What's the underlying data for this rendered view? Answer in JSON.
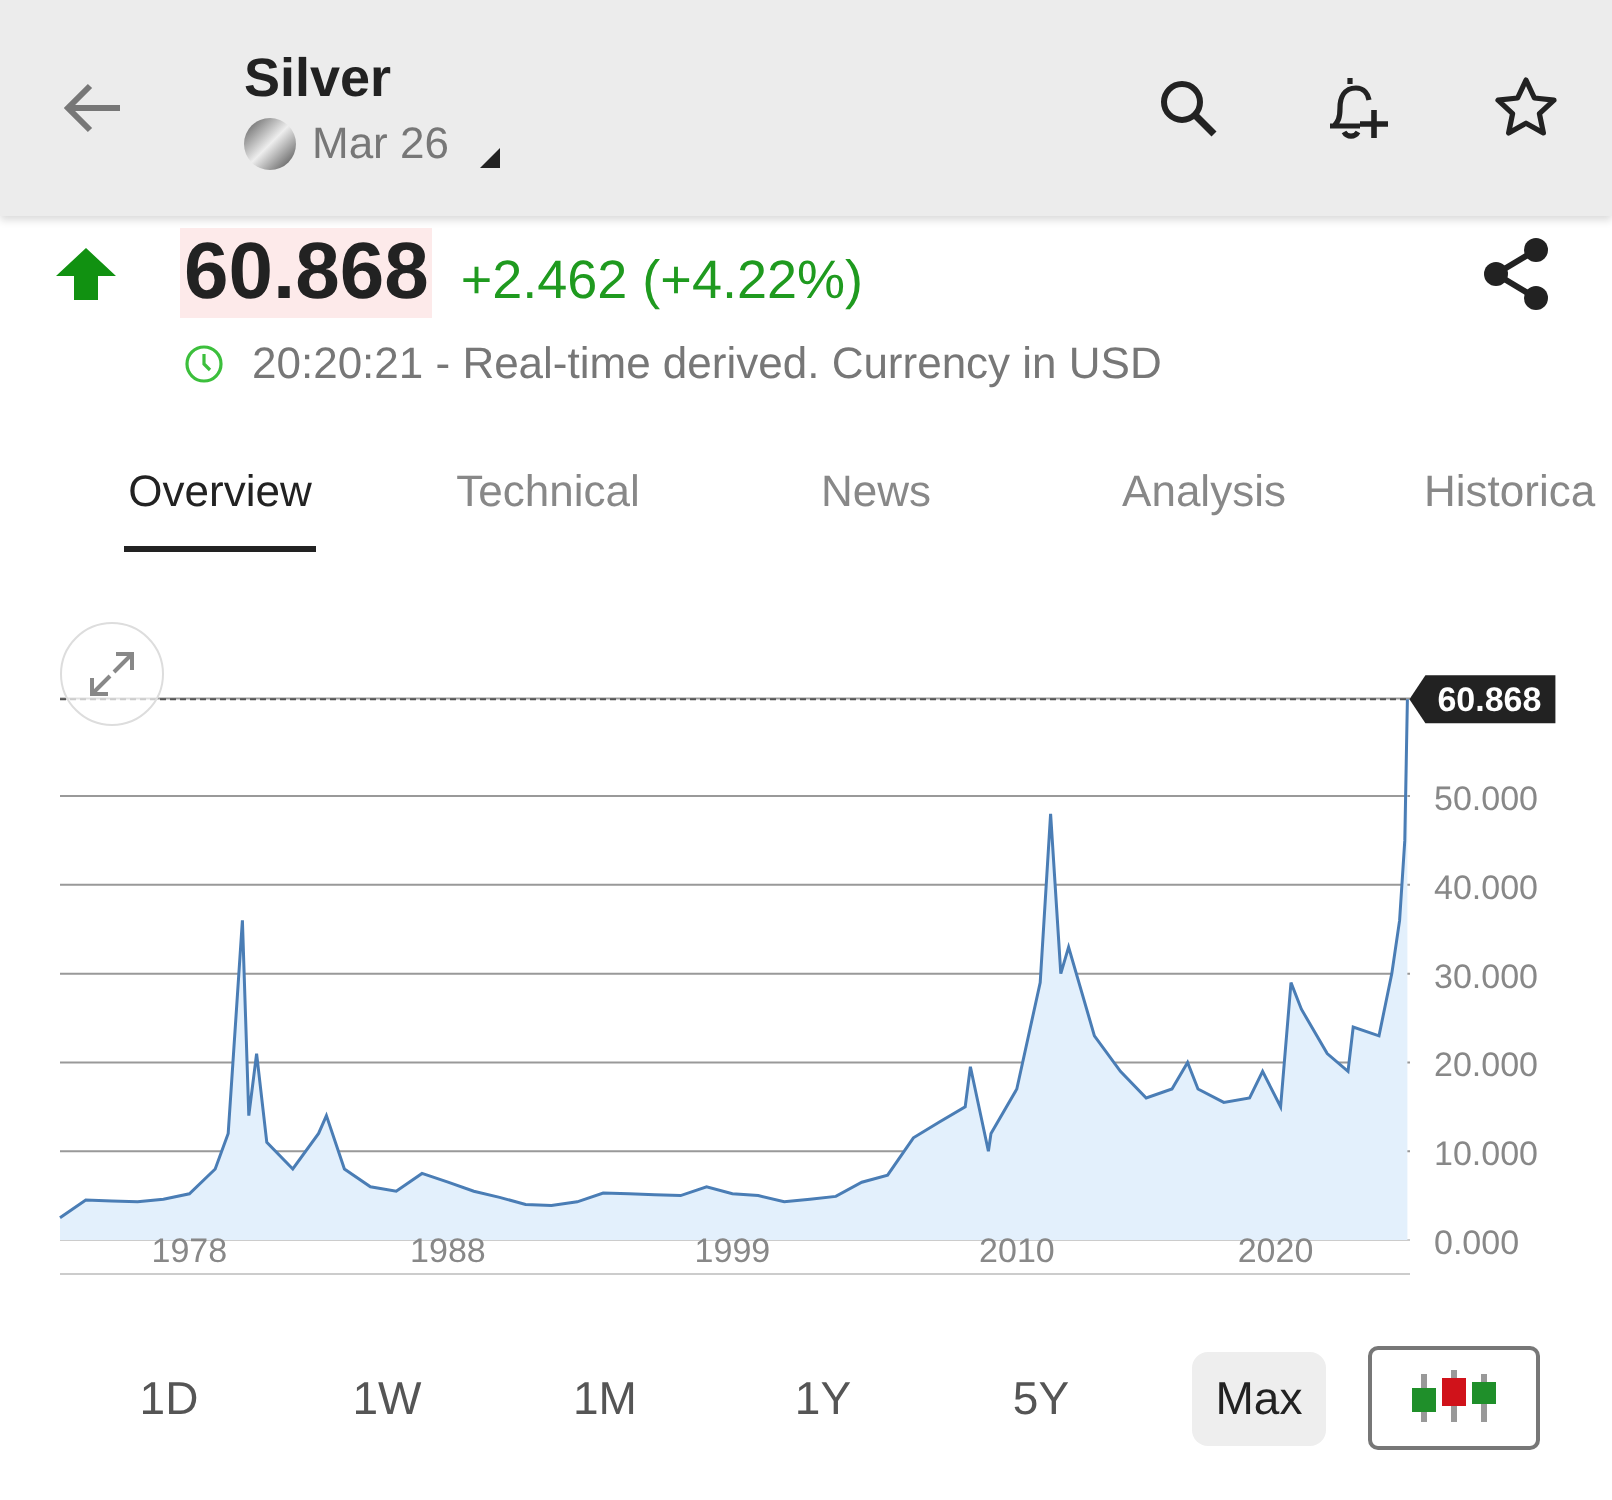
{
  "header": {
    "title": "Silver",
    "contract": "Mar 26"
  },
  "quote": {
    "positive": true,
    "price": "60.868",
    "change": "+2.462 (+4.22%)",
    "status": "20:20:21 - Real-time derived. Currency in USD"
  },
  "tabs": [
    {
      "label": "Overview",
      "selected": true
    },
    {
      "label": "Technical",
      "selected": false
    },
    {
      "label": "News",
      "selected": false
    },
    {
      "label": "Analysis",
      "selected": false
    },
    {
      "label": "Historica",
      "selected": false
    }
  ],
  "chart": {
    "chart_data": {
      "type": "area",
      "x": [
        1973,
        1974,
        1975,
        1976,
        1977,
        1978,
        1979,
        1979.5,
        1980.05,
        1980.3,
        1980.6,
        1981,
        1982,
        1983,
        1983.3,
        1984,
        1985,
        1986,
        1987,
        1988,
        1989,
        1990,
        1991,
        1992,
        1993,
        1994,
        1995,
        1996,
        1997,
        1998,
        1999,
        2000,
        2001,
        2002,
        2003,
        2004,
        2005,
        2006,
        2007,
        2008,
        2008.2,
        2008.9,
        2009,
        2010,
        2010.9,
        2011.3,
        2011.7,
        2012,
        2013,
        2014,
        2015,
        2016,
        2016.6,
        2017,
        2018,
        2019,
        2019.5,
        2020.2,
        2020.6,
        2021,
        2022,
        2022.8,
        2023,
        2024,
        2024.5,
        2024.8,
        2025,
        2025.1
      ],
      "series": [
        {
          "color": "#4a7db5",
          "values": [
            2.5,
            4.5,
            4.4,
            4.3,
            4.6,
            5.2,
            8,
            12,
            36,
            14,
            21,
            11,
            8,
            12,
            14,
            8,
            6,
            5.5,
            7.5,
            6.5,
            5.5,
            4.8,
            4,
            3.9,
            4.3,
            5.3,
            5.2,
            5.1,
            5,
            6,
            5.2,
            5,
            4.3,
            4.6,
            4.9,
            6.5,
            7.3,
            11.5,
            13.3,
            15,
            19.5,
            10,
            12,
            17,
            29,
            48,
            30,
            33,
            23,
            19,
            16,
            17,
            20,
            17,
            15.5,
            16,
            19,
            15,
            29,
            26,
            21,
            19,
            24,
            23,
            30,
            36,
            45,
            60.9
          ]
        }
      ],
      "xlim": [
        1973,
        2025.2
      ],
      "ylim": [
        0,
        61
      ],
      "grid": true,
      "xticks": [
        {
          "value": 1978,
          "label": "1978"
        },
        {
          "value": 1988,
          "label": "1988"
        },
        {
          "value": 1999,
          "label": "1999"
        },
        {
          "value": 2010,
          "label": "2010"
        },
        {
          "value": 2020,
          "label": "2020"
        }
      ],
      "yticks": [
        {
          "value": 0,
          "label": "0.000"
        },
        {
          "value": 10,
          "label": "10.000"
        },
        {
          "value": 20,
          "label": "20.000"
        },
        {
          "value": 30,
          "label": "30.000"
        },
        {
          "value": 40,
          "label": "40.000"
        },
        {
          "value": 50,
          "label": "50.000"
        }
      ],
      "annotations": [
        {
          "x": 2025.1,
          "y": 60.9,
          "text": "60.868"
        }
      ]
    }
  },
  "ranges": [
    {
      "label": "1D",
      "selected": false
    },
    {
      "label": "1W",
      "selected": false
    },
    {
      "label": "1M",
      "selected": false
    },
    {
      "label": "1Y",
      "selected": false
    },
    {
      "label": "5Y",
      "selected": false
    },
    {
      "label": "Max",
      "selected": true
    }
  ]
}
